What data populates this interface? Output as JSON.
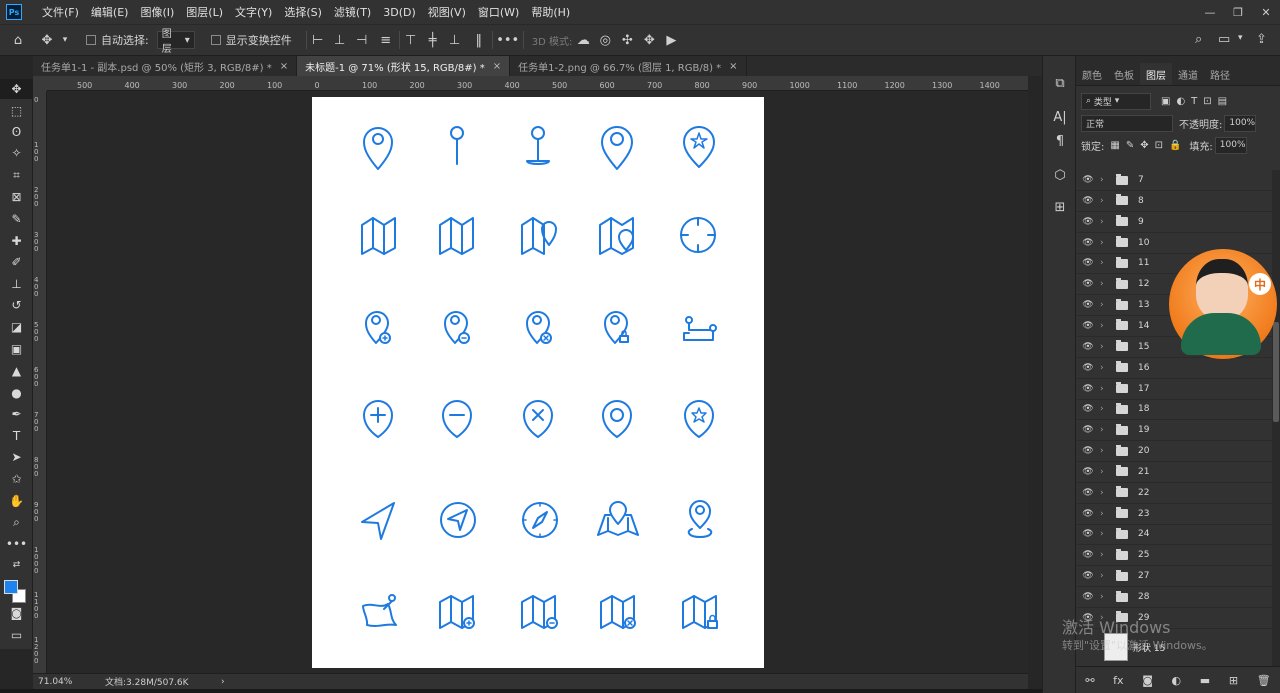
{
  "app": {
    "logo": "Ps",
    "menu": [
      "文件(F)",
      "编辑(E)",
      "图像(I)",
      "图层(L)",
      "文字(Y)",
      "选择(S)",
      "滤镜(T)",
      "3D(D)",
      "视图(V)",
      "窗口(W)",
      "帮助(H)"
    ]
  },
  "options": {
    "auto_select_label": "自动选择:",
    "auto_select_value": "图层",
    "show_transform_label": "显示变换控件",
    "mode_3d_label": "3D 模式:",
    "more": "•••"
  },
  "tabs": [
    {
      "label": "任务单1-1 - 副本.psd @ 50% (矩形 3, RGB/8#) *",
      "close": "×"
    },
    {
      "label": "未标题-1 @ 71% (形状 15, RGB/8#) *",
      "close": "×"
    },
    {
      "label": "任务单1-2.png @ 66.7% (图层 1, RGB/8) *",
      "close": "×"
    }
  ],
  "ruler": {
    "h_ticks": [
      "500",
      "400",
      "300",
      "200",
      "100",
      "0",
      "100",
      "200",
      "300",
      "400",
      "500",
      "600",
      "700",
      "800",
      "900",
      "1000",
      "1100",
      "1200",
      "1300",
      "1400"
    ],
    "v_ticks": [
      "0",
      "1 0 0",
      "2 0 0",
      "3 0 0",
      "4 0 0",
      "5 0 0",
      "6 0 0",
      "7 0 0",
      "8 0 0",
      "9 0 0",
      "1 0 0 0",
      "1 1 0 0",
      "1 2 0 0",
      "1 3 0 0"
    ]
  },
  "status": {
    "zoom": "71.04%",
    "doc_info": "文档:3.28M/507.6K",
    "arrow": "›"
  },
  "panel": {
    "tabs": [
      "颜色",
      "色板",
      "图层",
      "通道",
      "路径"
    ],
    "kind_filter": "类型",
    "blend_mode": "正常",
    "opacity_label": "不透明度:",
    "opacity_value": "100%",
    "lock_label": "锁定:",
    "fill_label": "填充:",
    "fill_value": "100%",
    "layers": [
      "7",
      "8",
      "9",
      "10",
      "11",
      "12",
      "13",
      "14",
      "15",
      "16",
      "17",
      "18",
      "19",
      "20",
      "21",
      "22",
      "23",
      "24",
      "25",
      "27",
      "28",
      "29"
    ],
    "bottom_layer": "形状 15"
  },
  "watermark": {
    "line1": "激活 Windows",
    "line2": "转到\"设置\"以激活 Windows。"
  },
  "avatar": {
    "badge": "中"
  },
  "colors": {
    "icon_blue": "#1f7ae0",
    "foreground": "#1e82f0",
    "background_swatch": "#ffffff"
  }
}
